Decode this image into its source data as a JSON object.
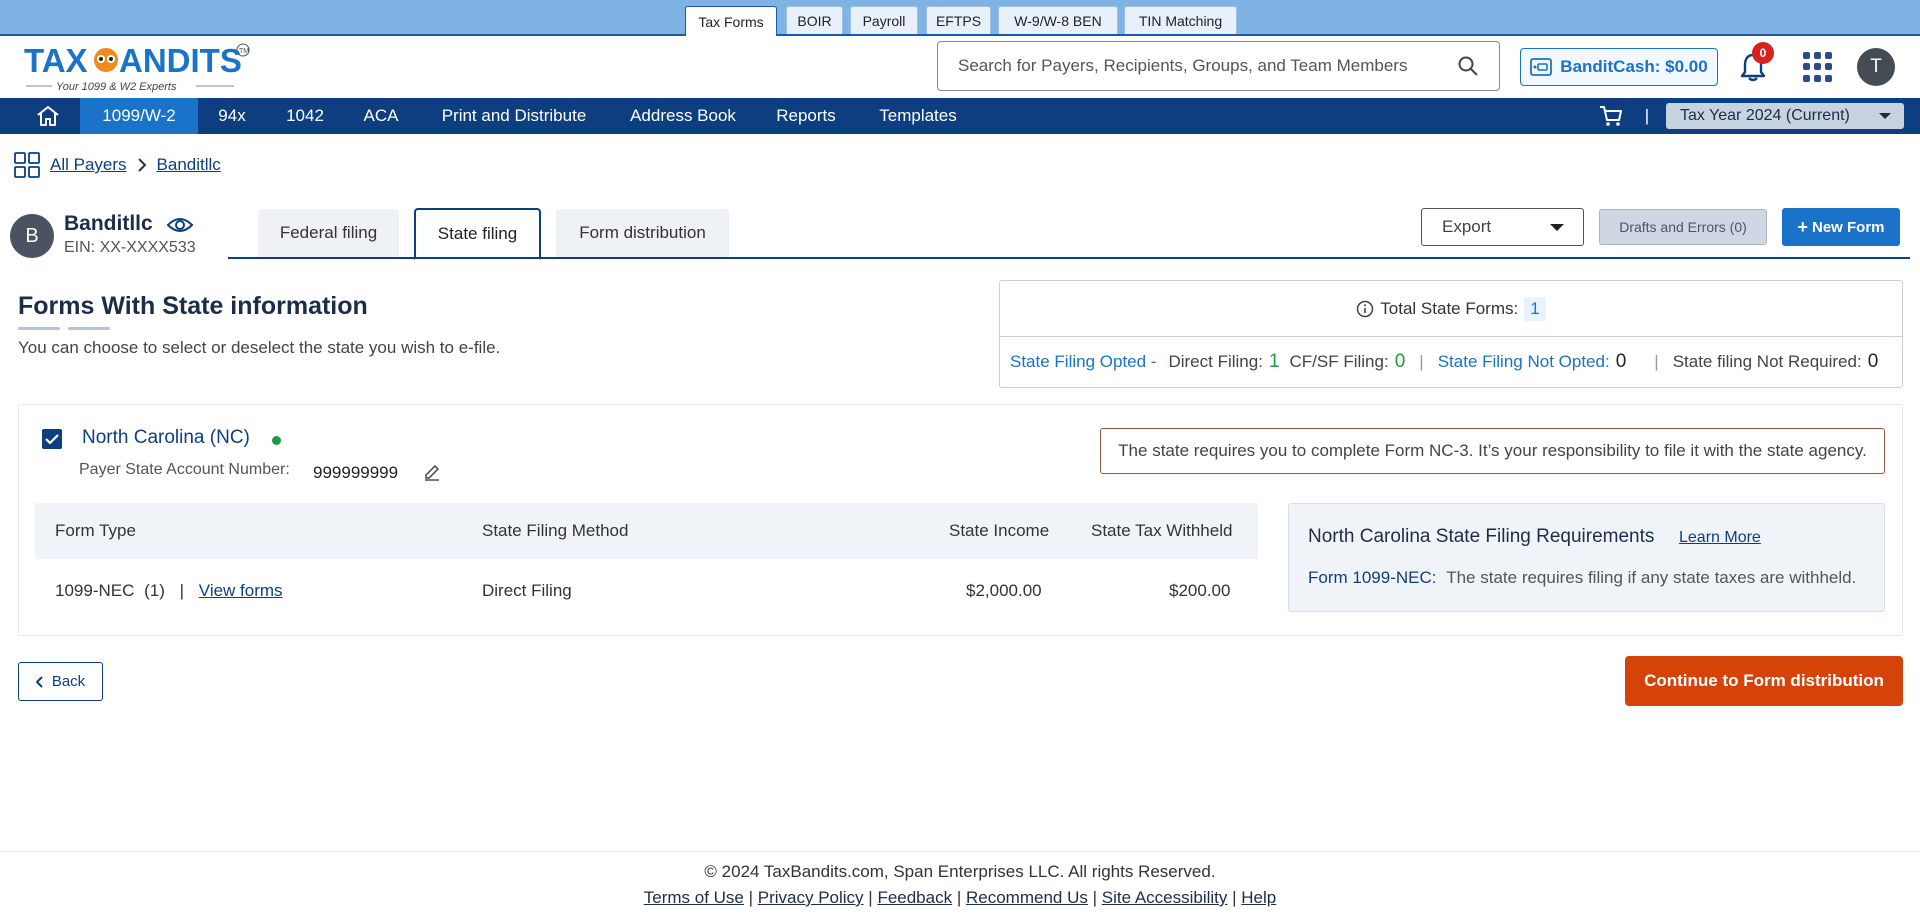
{
  "product_tabs": [
    {
      "label": "Tax Forms",
      "active": true
    },
    {
      "label": "BOIR"
    },
    {
      "label": "Payroll"
    },
    {
      "label": "EFTPS"
    },
    {
      "label": "W-9/W-8 BEN"
    },
    {
      "label": "TIN Matching"
    }
  ],
  "header": {
    "logo_text": "TAXBANDITS",
    "logo_tagline": "Your 1099 & W2 Experts",
    "search_placeholder": "Search for Payers, Recipients, Groups, and Team Members",
    "bandit_cash": "BanditCash: $0.00",
    "notification_count": "0",
    "user_initial": "T"
  },
  "nav": {
    "items": [
      "1099/W-2",
      "94x",
      "1042",
      "ACA",
      "Print and Distribute",
      "Address Book",
      "Reports",
      "Templates"
    ],
    "active": "1099/W-2",
    "tax_year": "Tax Year 2024 (Current)",
    "divider": "|"
  },
  "breadcrumb": {
    "root": "All Payers",
    "current": "Banditllc"
  },
  "payer": {
    "initial": "B",
    "name": "Banditllc",
    "ein": "EIN: XX-XXXX533"
  },
  "filing_tabs": [
    "Federal filing",
    "State filing",
    "Form distribution"
  ],
  "actions": {
    "export": "Export",
    "drafts": "Drafts and Errors (0)",
    "new_form": "New Form"
  },
  "section": {
    "title": "Forms With State information",
    "subtitle": "You can choose to select or deselect the state you wish to e-file."
  },
  "summary": {
    "total_label": "Total State Forms:",
    "total_value": "1",
    "opted_label": "State Filing Opted -",
    "direct_label": "Direct Filing:",
    "direct_value": "1",
    "cfsf_label": "CF/SF Filing:",
    "cfsf_value": "0",
    "not_opted_label": "State Filing Not Opted:",
    "not_opted_value": "0",
    "not_required_label": "State filing Not Required:",
    "not_required_value": "0"
  },
  "state": {
    "name": "North Carolina (NC)",
    "account_label": "Payer State Account Number:",
    "account_value": "999999999",
    "notice": "The state requires you to complete Form NC-3. It’s your responsibility to file it with the state agency.",
    "table": {
      "headers": [
        "Form Type",
        "State Filing Method",
        "State Income",
        "State Tax Withheld"
      ],
      "rows": [
        {
          "form_type": "1099-NEC",
          "count": "(1)",
          "view": "View forms",
          "method": "Direct Filing",
          "income": "$2,000.00",
          "withheld": "$200.00"
        }
      ]
    },
    "requirements": {
      "title": "North Carolina State Filing Requirements",
      "learn_more": "Learn More",
      "form_label": "Form 1099-NEC:",
      "form_text": "The state requires filing if any state taxes are withheld."
    }
  },
  "buttons": {
    "back": "Back",
    "continue": "Continue to Form distribution"
  },
  "footer": {
    "copyright": "© 2024 TaxBandits.com, Span Enterprises LLC. All rights Reserved.",
    "links": [
      "Terms of Use",
      "Privacy Policy",
      "Feedback",
      "Recommend Us",
      "Site Accessibility",
      "Help"
    ]
  },
  "colors": {
    "nav": "#0d3f80",
    "accent": "#1a73c8",
    "cta": "#d64309",
    "success": "#1f9a3e"
  }
}
